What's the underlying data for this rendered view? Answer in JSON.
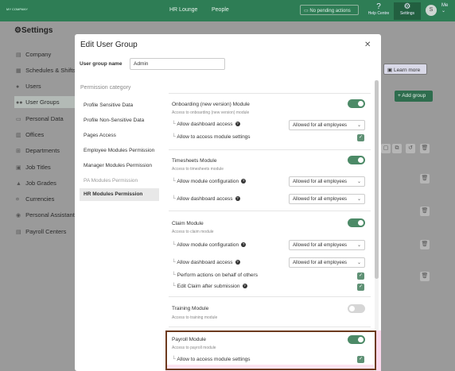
{
  "topbar": {
    "logo": "MY COMPANY",
    "nav": [
      "HR Lounge",
      "People"
    ],
    "pending": "No pending actions",
    "help": "Help Centre",
    "settings": "Settings",
    "avatar_initial": "S",
    "me": "Me"
  },
  "page": {
    "title": "Settings"
  },
  "sidebar": {
    "items": [
      {
        "label": "Company",
        "icon": "building-icon"
      },
      {
        "label": "Schedules & Shifts",
        "icon": "calendar-icon"
      },
      {
        "label": "Users",
        "icon": "user-icon"
      },
      {
        "label": "User Groups",
        "icon": "users-icon"
      },
      {
        "label": "Personal Data",
        "icon": "id-card-icon"
      },
      {
        "label": "Offices",
        "icon": "office-icon"
      },
      {
        "label": "Departments",
        "icon": "sitemap-icon"
      },
      {
        "label": "Job Titles",
        "icon": "briefcase-icon"
      },
      {
        "label": "Job Grades",
        "icon": "grade-icon"
      },
      {
        "label": "Currencies",
        "icon": "currency-icon"
      },
      {
        "label": "Personal Assistant",
        "icon": "assistant-icon"
      },
      {
        "label": "Payroll Centers",
        "icon": "payroll-icon"
      }
    ]
  },
  "bg_buttons": {
    "learn_more": "Learn more",
    "add_group": "+ Add group"
  },
  "modal": {
    "title": "Edit User Group",
    "name_label": "User group name",
    "name_value": "Admin",
    "perm_head": "Permission category",
    "categories": [
      "Profile Sensitive Data",
      "Profile Non-Sensitive Data",
      "Pages Access",
      "Employee Modules Permission",
      "Manager Modules Permission",
      "PA Modules Permission",
      "HR Modules Permission"
    ],
    "modules": {
      "onboarding": {
        "title": "Onboarding (new version) Module",
        "desc": "Access to onboarding (new version) module",
        "dashboard": "Allow dashboard access",
        "dashboard_value": "Allowed for all employees",
        "settings": "Allow to access module settings"
      },
      "timesheets": {
        "title": "Timesheets Module",
        "desc": "Access to timesheets module",
        "config": "Allow module configuration",
        "config_value": "Allowed for all employees",
        "dashboard": "Allow dashboard access",
        "dashboard_value": "Allowed for all employees"
      },
      "claim": {
        "title": "Claim Module",
        "desc": "Access to claim module",
        "config": "Allow module configuration",
        "config_value": "Allowed for all employees",
        "dashboard": "Allow dashboard access",
        "dashboard_value": "Allowed for all employees",
        "behalf": "Perform actions on behalf of others",
        "edit_claim": "Edit Claim after submission"
      },
      "training": {
        "title": "Training Module",
        "desc": "Access to training module"
      },
      "payroll": {
        "title": "Payroll Module",
        "desc": "Access to payroll module",
        "settings": "Allow to access module settings"
      }
    }
  },
  "colors": {
    "brand_green": "#2e7d55",
    "toggle_on": "#4c8a67",
    "highlight_border": "#6d3a1e"
  }
}
